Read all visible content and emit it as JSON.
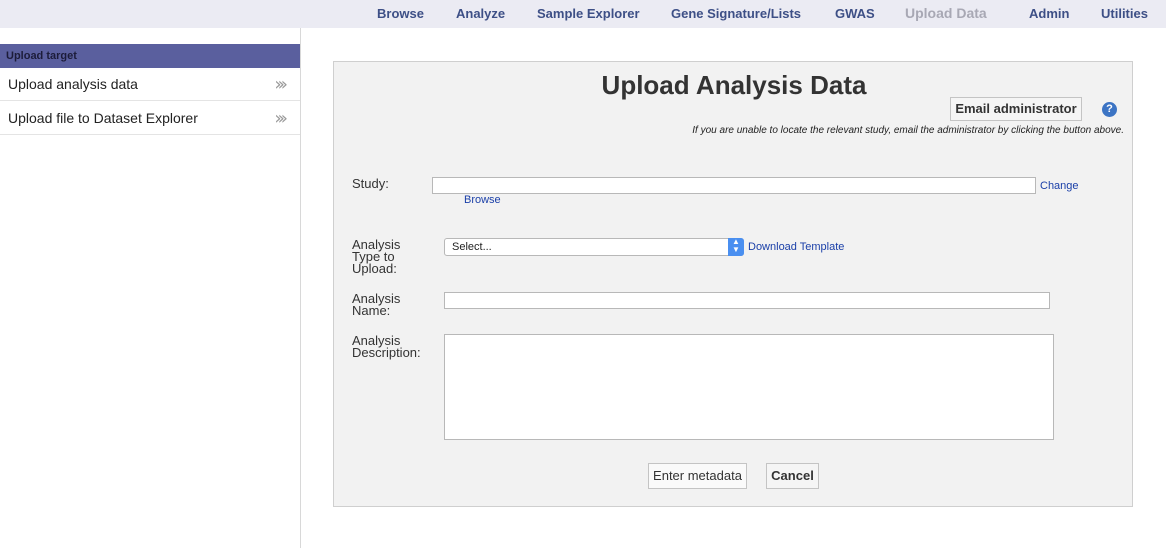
{
  "nav": {
    "items": [
      {
        "label": "Browse"
      },
      {
        "label": "Analyze"
      },
      {
        "label": "Sample Explorer"
      },
      {
        "label": "Gene Signature/Lists"
      },
      {
        "label": "GWAS"
      },
      {
        "label": "Upload Data",
        "active": true
      },
      {
        "label": "Admin"
      },
      {
        "label": "Utilities"
      }
    ]
  },
  "sidebar": {
    "header": "Upload target",
    "items": [
      {
        "label": "Upload analysis data"
      },
      {
        "label": "Upload file to Dataset Explorer"
      }
    ]
  },
  "form": {
    "title": "Upload Analysis Data",
    "email_button": "Email administrator",
    "help_icon": "?",
    "note": "If you are unable to locate the relevant study, email the administrator by clicking the button above.",
    "study_label": "Study:",
    "study_value": "",
    "change_link": "Change",
    "browse_link": "Browse",
    "analysis_type_label_1": "Analysis",
    "analysis_type_label_2": "Type to",
    "analysis_type_label_3": "Upload:",
    "analysis_type_selected": "Select...",
    "download_template_link": "Download Template",
    "analysis_name_label_1": "Analysis",
    "analysis_name_label_2": "Name:",
    "analysis_name_value": "",
    "analysis_desc_label_1": "Analysis",
    "analysis_desc_label_2": "Description:",
    "analysis_desc_value": "",
    "enter_metadata_button": "Enter metadata",
    "cancel_button": "Cancel"
  },
  "colors": {
    "nav_background": "#ebebf3",
    "nav_text": "#3d4f86",
    "sidebar_header": "#5a5f9e",
    "link": "#1a3fa8",
    "help_icon": "#3c74c4"
  }
}
